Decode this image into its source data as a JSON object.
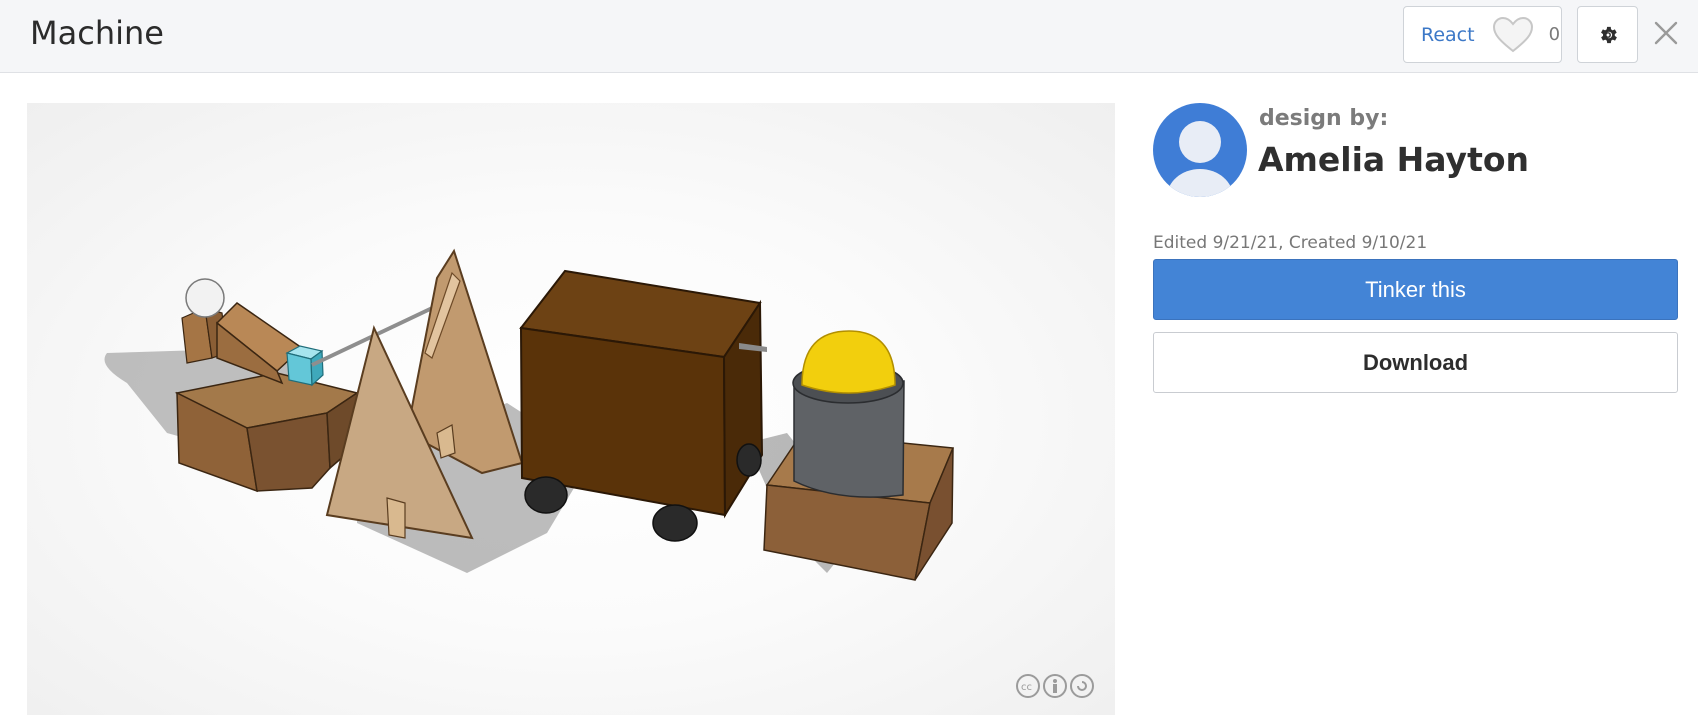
{
  "header": {
    "title": "Machine",
    "react_label": "React",
    "react_count": "0",
    "icons": {
      "heart": "heart-icon",
      "settings": "gear-icon",
      "close": "close-icon"
    }
  },
  "viewer": {
    "license_icon": "creative-commons-icon"
  },
  "designer": {
    "design_by_label": "design by:",
    "name": "Amelia Hayton"
  },
  "meta": {
    "dates": "Edited 9/21/21, Created 9/10/21"
  },
  "actions": {
    "tinker_label": "Tinker this",
    "download_label": "Download"
  },
  "colors": {
    "accent": "#4384d6",
    "link": "#3c78c7"
  }
}
